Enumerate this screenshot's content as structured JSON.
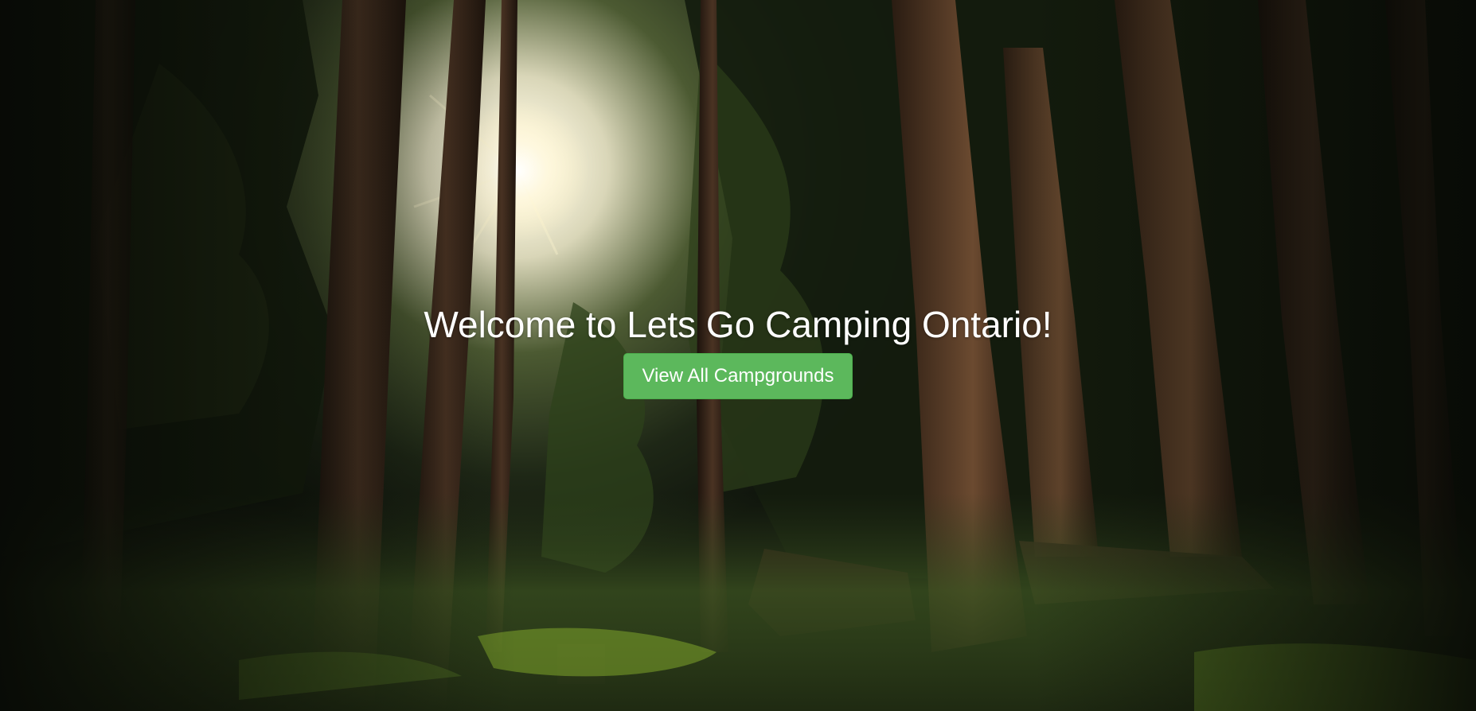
{
  "hero": {
    "title": "Welcome to Lets Go Camping Ontario!",
    "button_label": "View All Campgrounds",
    "background": "forest-with-sunlight-photo"
  },
  "colors": {
    "button_bg": "#5cb85c",
    "title_text": "#ffffff"
  }
}
